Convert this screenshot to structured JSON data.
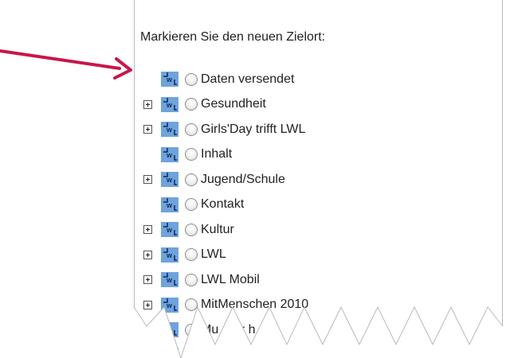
{
  "dialog": {
    "heading": "Markieren Sie den neuen Zielort:"
  },
  "tree": {
    "items": [
      {
        "label": "Daten versendet",
        "expandable": false
      },
      {
        "label": "Gesundheit",
        "expandable": true
      },
      {
        "label": "Girls'Day trifft LWL",
        "expandable": true
      },
      {
        "label": "Inhalt",
        "expandable": false
      },
      {
        "label": "Jugend/Schule",
        "expandable": true
      },
      {
        "label": "Kontakt",
        "expandable": false
      },
      {
        "label": "Kultur",
        "expandable": true
      },
      {
        "label": "LWL",
        "expandable": true
      },
      {
        "label": "LWL Mobil",
        "expandable": true
      },
      {
        "label": "MitMenschen 2010",
        "expandable": true
      },
      {
        "label": "Mu   rber   h",
        "expandable": true
      }
    ],
    "icon_name": "wl-folder-icon",
    "icon_color": "#6fa3dc"
  },
  "annotation": {
    "arrow_color": "#c8174a",
    "arrow_icon": "arrow-icon"
  }
}
